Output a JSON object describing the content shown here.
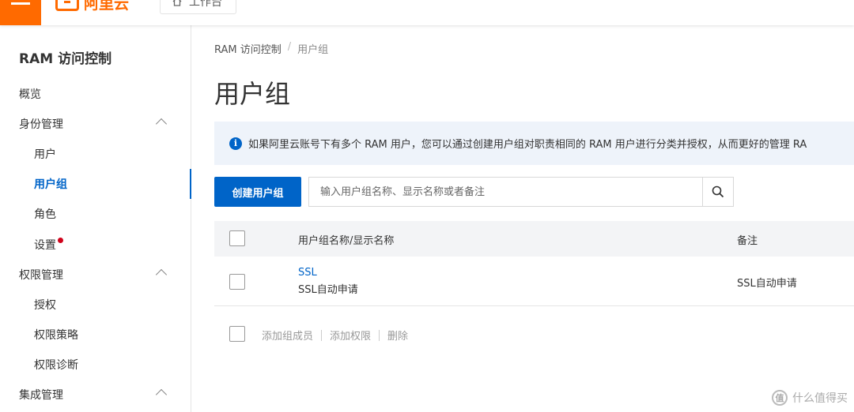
{
  "topbar": {
    "logo_text": "阿里云",
    "workbench_label": "工作台",
    "brand_color": "#ff6a00"
  },
  "sidebar": {
    "title": "RAM 访问控制",
    "items": [
      {
        "label": "概览"
      },
      {
        "label": "身份管理"
      },
      {
        "label": "用户"
      },
      {
        "label": "用户组"
      },
      {
        "label": "角色"
      },
      {
        "label": "设置"
      },
      {
        "label": "权限管理"
      },
      {
        "label": "授权"
      },
      {
        "label": "权限策略"
      },
      {
        "label": "权限诊断"
      },
      {
        "label": "集成管理"
      }
    ]
  },
  "breadcrumb": {
    "root": "RAM 访问控制",
    "sep": "/",
    "current": "用户组"
  },
  "page": {
    "title": "用户组",
    "info_text": "如果阿里云账号下有多个 RAM 用户，您可以通过创建用户组对职责相同的 RAM 用户进行分类并授权，从而更好的管理 RA",
    "create_button": "创建用户组",
    "search_placeholder": "输入用户组名称、显示名称或者备注"
  },
  "table": {
    "headers": {
      "name": "用户组名称/显示名称",
      "note": "备注"
    },
    "rows": [
      {
        "name": "SSL",
        "display_name": "SSL自动申请",
        "note": "SSL自动申请"
      }
    ]
  },
  "footer_actions": {
    "add_members": "添加组成员",
    "add_permission": "添加权限",
    "delete": "删除"
  },
  "watermark": {
    "text": "什么值得买",
    "icon_char": "值"
  },
  "accent_color": "#0064c8"
}
